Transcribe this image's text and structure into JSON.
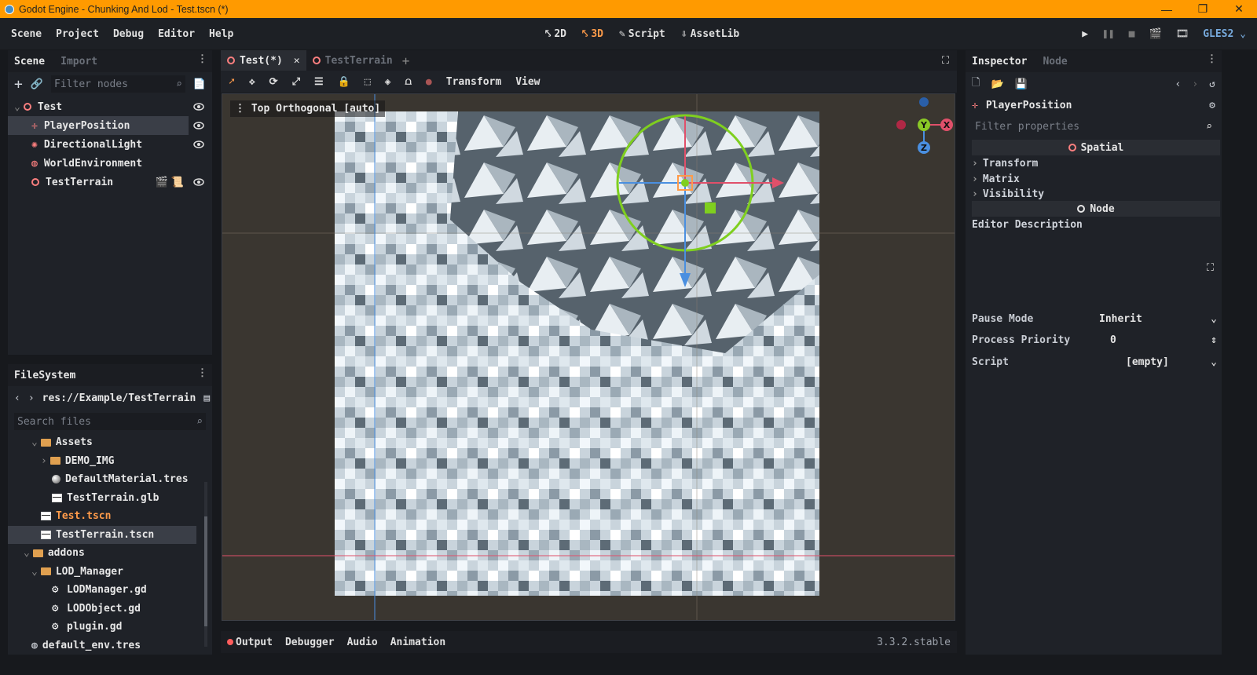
{
  "window": {
    "title": "Godot Engine - Chunking And Lod - Test.tscn (*)",
    "minimize": "—",
    "restore": "❐",
    "close": "✕"
  },
  "menu": [
    "Scene",
    "Project",
    "Debug",
    "Editor",
    "Help"
  ],
  "modes": [
    {
      "label": "2D",
      "icon": "2d-icon"
    },
    {
      "label": "3D",
      "icon": "3d-icon",
      "active": true
    },
    {
      "label": "Script",
      "icon": "script-icon"
    },
    {
      "label": "AssetLib",
      "icon": "assetlib-icon"
    }
  ],
  "renderer": "GLES2",
  "scene_dock": {
    "tabs": [
      "Scene",
      "Import"
    ],
    "filter_placeholder": "Filter nodes",
    "nodes": [
      {
        "label": "Test",
        "icon": "spatial-icon"
      },
      {
        "label": "PlayerPosition",
        "icon": "position3d-icon",
        "selected": true
      },
      {
        "label": "DirectionalLight",
        "icon": "light-icon"
      },
      {
        "label": "WorldEnvironment",
        "icon": "globe-icon"
      },
      {
        "label": "TestTerrain",
        "icon": "spatial-icon"
      }
    ]
  },
  "filesystem": {
    "title": "FileSystem",
    "path": "res://Example/TestTerrain",
    "search_placeholder": "Search files",
    "items": [
      {
        "label": "Assets",
        "type": "folder"
      },
      {
        "label": "DEMO_IMG",
        "type": "folder"
      },
      {
        "label": "DefaultMaterial.tres",
        "type": "material"
      },
      {
        "label": "TestTerrain.glb",
        "type": "scene"
      },
      {
        "label": "Test.tscn",
        "type": "scene",
        "open": true
      },
      {
        "label": "TestTerrain.tscn",
        "type": "scene",
        "selected": true
      },
      {
        "label": "addons",
        "type": "folder"
      },
      {
        "label": "LOD_Manager",
        "type": "folder"
      },
      {
        "label": "LODManager.gd",
        "type": "script"
      },
      {
        "label": "LODObject.gd",
        "type": "script"
      },
      {
        "label": "plugin.gd",
        "type": "script"
      },
      {
        "label": "default_env.tres",
        "type": "env"
      }
    ]
  },
  "editor_tabs": [
    {
      "label": "Test(*)",
      "active": true
    },
    {
      "label": "TestTerrain"
    }
  ],
  "viewport": {
    "label": "Top Orthogonal [auto]",
    "menus": [
      "Transform",
      "View"
    ]
  },
  "bottom_tabs": [
    "Output",
    "Debugger",
    "Audio",
    "Animation"
  ],
  "version": "3.3.2.stable",
  "inspector": {
    "tabs": [
      "Inspector",
      "Node"
    ],
    "node_name": "PlayerPosition",
    "filter_placeholder": "Filter properties",
    "section_spatial": "Spatial",
    "groups": [
      "Transform",
      "Matrix",
      "Visibility"
    ],
    "section_node": "Node",
    "editor_description": "Editor Description",
    "props": [
      {
        "key": "Pause Mode",
        "value": "Inherit"
      },
      {
        "key": "Process Priority",
        "value": "0"
      },
      {
        "key": "Script",
        "value": "[empty]"
      }
    ]
  },
  "gizmo_axes": [
    "Y",
    "X",
    "Z"
  ]
}
